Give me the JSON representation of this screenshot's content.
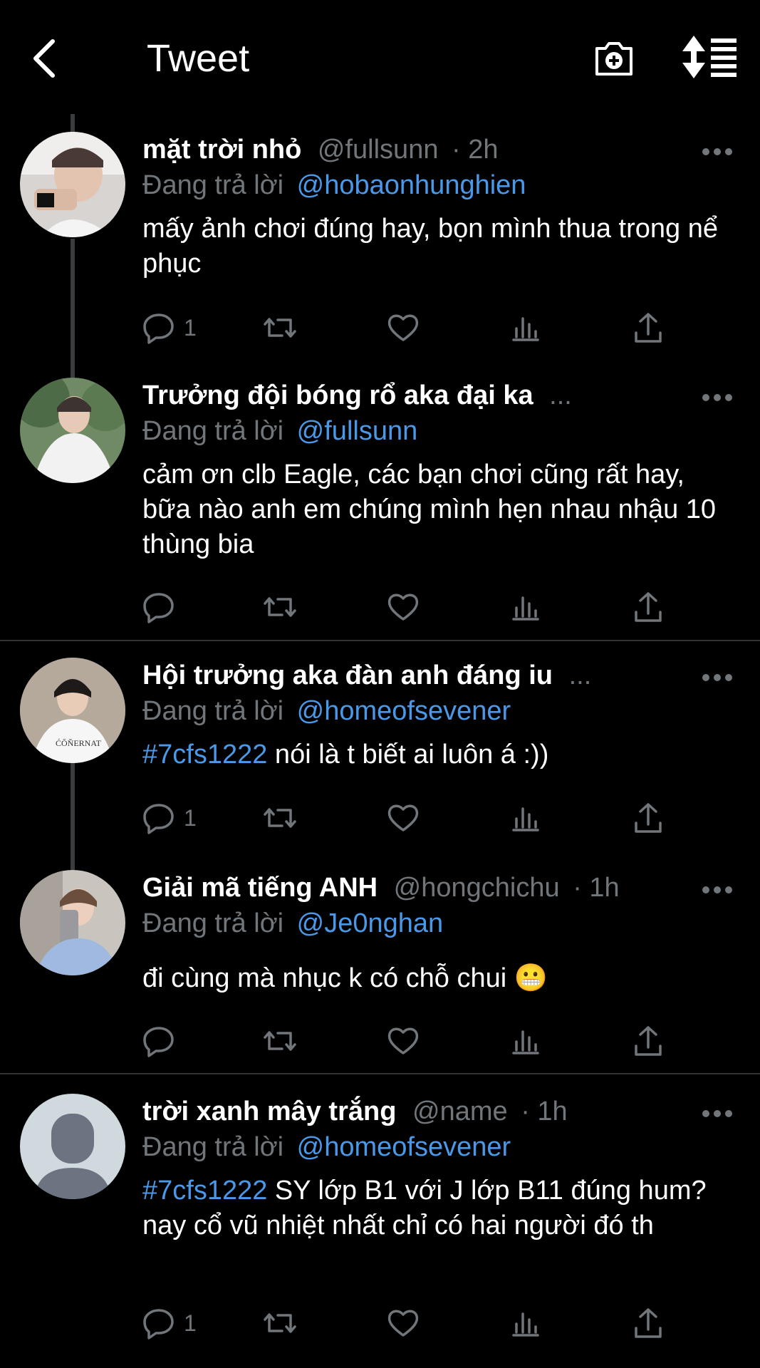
{
  "header": {
    "title": "Tweet"
  },
  "tweets": [
    {
      "name": "mặt trời nhỏ",
      "handle": "@fullsunn",
      "time": "· 2h",
      "reply_prefix": "Đang trả lời",
      "reply_to": "@hobaonhunghien",
      "hashtag": "",
      "text": "mấy ảnh chơi đúng hay, bọn mình thua trong nể phục",
      "reply_count": "1"
    },
    {
      "name": "Trưởng đội bóng rổ aka đại ka",
      "handle": "...",
      "time": "",
      "reply_prefix": "Đang trả lời",
      "reply_to": "@fullsunn",
      "hashtag": "",
      "text": "cảm ơn clb Eagle, các bạn chơi cũng rất hay, bữa nào anh em chúng mình hẹn nhau nhậu 10 thùng bia",
      "reply_count": ""
    },
    {
      "name": "Hội trưởng aka đàn anh đáng iu",
      "handle": "...",
      "time": "",
      "reply_prefix": "Đang trả lời",
      "reply_to": "@homeofsevener",
      "hashtag": "#7cfs1222",
      "text": " nói là t biết ai luôn á :))",
      "reply_count": "1"
    },
    {
      "name": "Giải mã tiếng ANH",
      "handle": "@hongchichu",
      "time": "· 1h",
      "reply_prefix": "Đang trả lời",
      "reply_to": "@Je0nghan",
      "hashtag": "",
      "text": "đi cùng mà nhục k có chỗ chui 😬",
      "reply_count": ""
    },
    {
      "name": "trời xanh mây trắng",
      "handle": "@name",
      "time": "· 1h",
      "reply_prefix": "Đang trả lời",
      "reply_to": "@homeofsevener",
      "hashtag": "#7cfs1222",
      "text": " SY lớp B1 với J lớp B11 đúng hum? nay cổ vũ nhiệt nhất chỉ có hai người đó th",
      "reply_count": "1"
    }
  ],
  "icons": {
    "back": "chevron-left-icon",
    "camera": "camera-plus-icon",
    "sort": "sort-icon",
    "more": "more-horizontal-icon",
    "reply": "reply-icon",
    "retweet": "retweet-icon",
    "like": "heart-icon",
    "views": "analytics-icon",
    "share": "share-icon"
  },
  "colors": {
    "link": "#4a99e9",
    "muted": "#71767b",
    "background": "#000000"
  }
}
